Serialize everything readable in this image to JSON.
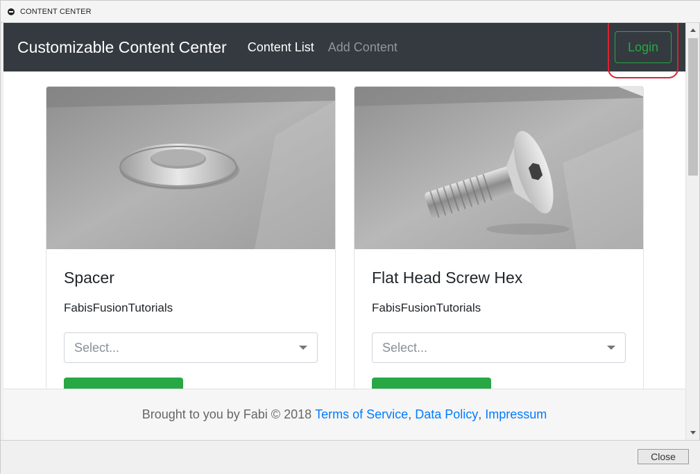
{
  "window": {
    "title": "CONTENT CENTER"
  },
  "navbar": {
    "brand": "Customizable Content Center",
    "links": [
      {
        "label": "Content List",
        "active": true
      },
      {
        "label": "Add Content",
        "active": false
      }
    ],
    "login_label": "Login"
  },
  "cards": [
    {
      "title": "Spacer",
      "author": "FabisFusionTutorials",
      "select_placeholder": "Select...",
      "image": "spacer-washer-render"
    },
    {
      "title": "Flat Head Screw Hex",
      "author": "FabisFusionTutorials",
      "select_placeholder": "Select...",
      "image": "flat-head-screw-render"
    }
  ],
  "footer": {
    "text": "Brought to you by Fabi © 2018",
    "links": [
      "Terms of Service",
      "Data Policy",
      "Impressum"
    ]
  },
  "dialog": {
    "close_label": "Close"
  },
  "colors": {
    "navbar": "#343a40",
    "accent": "#28a745",
    "link": "#007bff",
    "highlight": "#d9232f"
  }
}
